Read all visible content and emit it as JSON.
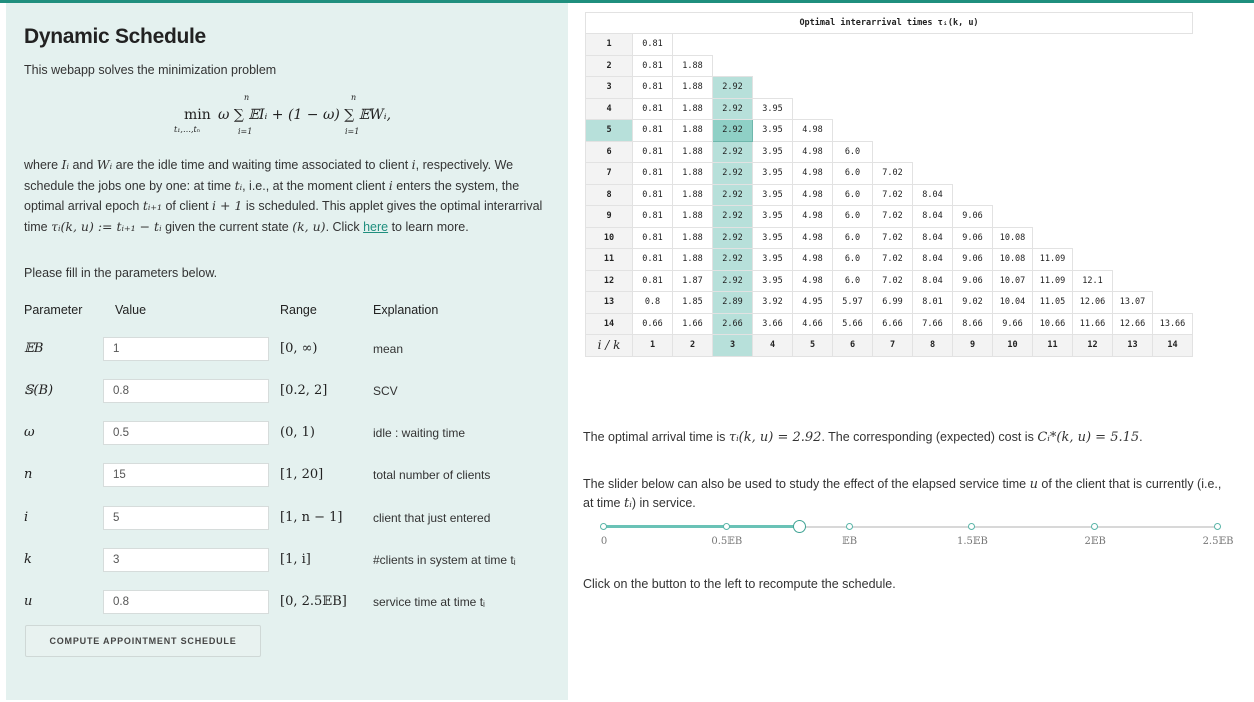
{
  "title": "Dynamic Schedule",
  "intro": "This webapp solves the minimization problem",
  "formula": {
    "min": "min",
    "subscript": "t₁,…,tₙ",
    "expr": "ω ∑ 𝔼Iᵢ + (1 − ω) ∑ 𝔼Wᵢ,",
    "sum_top": "n",
    "sum_bottom": "i=1"
  },
  "description": {
    "p1a": "where ",
    "p1_Ii": "Iᵢ",
    "p1b": " and ",
    "p1_Wi": "Wᵢ",
    "p1c": " are the idle time and waiting time associated to client ",
    "p1_i": "i",
    "p1d": ", respectively. We schedule the jobs one by one: at time ",
    "p1_ti": "tᵢ",
    "p1e": ", i.e., at the moment client ",
    "p1_i2": "i",
    "p1f": " enters the system, the optimal arrival epoch ",
    "p1_ti1": "tᵢ₊₁",
    "p1g": " of client ",
    "p1_i1": "i + 1",
    "p1h": " is scheduled. This applet gives the optimal interarrival time ",
    "p1_tau": "τᵢ(k, u) := tᵢ₊₁ − tᵢ",
    "p1i": " given the current state ",
    "p1_ku": "(k, u)",
    "p1j": ". Click ",
    "link": "here",
    "p1k": " to learn more."
  },
  "fill_in": "Please fill in the parameters below.",
  "param_headers": {
    "parameter": "Parameter",
    "value": "Value",
    "range": "Range",
    "explanation": "Explanation"
  },
  "params": [
    {
      "name": "𝔼B",
      "value": "1",
      "range": "[0, ∞)",
      "explanation": "mean"
    },
    {
      "name": "𝕊(B)",
      "value": "0.8",
      "range": "[0.2, 2]",
      "explanation": "SCV"
    },
    {
      "name": "ω",
      "value": "0.5",
      "range": "(0, 1)",
      "explanation": "idle : waiting time"
    },
    {
      "name": "n",
      "value": "15",
      "range": "[1, 20]",
      "explanation": "total number of clients"
    },
    {
      "name": "i",
      "value": "5",
      "range": "[1, n − 1]",
      "explanation": "client that just entered"
    },
    {
      "name": "k",
      "value": "3",
      "range": "[1, i]",
      "explanation": "#clients in system at time tᵢ"
    },
    {
      "name": "u",
      "value": "0.8",
      "range": "[0, 2.5𝔼B]",
      "explanation": "service time at time tᵢ"
    }
  ],
  "button_label": "COMPUTE APPOINTMENT SCHEDULE",
  "table": {
    "title": "Optimal interarrival times τᵢ(k, u)",
    "corner": "i / k",
    "col_headers": [
      "1",
      "2",
      "3",
      "4",
      "5",
      "6",
      "7",
      "8",
      "9",
      "10",
      "11",
      "12",
      "13",
      "14"
    ],
    "highlight_row": 5,
    "highlight_col": 3,
    "rows": [
      {
        "label": "1",
        "values": [
          "0.81"
        ]
      },
      {
        "label": "2",
        "values": [
          "0.81",
          "1.88"
        ]
      },
      {
        "label": "3",
        "values": [
          "0.81",
          "1.88",
          "2.92"
        ]
      },
      {
        "label": "4",
        "values": [
          "0.81",
          "1.88",
          "2.92",
          "3.95"
        ]
      },
      {
        "label": "5",
        "values": [
          "0.81",
          "1.88",
          "2.92",
          "3.95",
          "4.98"
        ]
      },
      {
        "label": "6",
        "values": [
          "0.81",
          "1.88",
          "2.92",
          "3.95",
          "4.98",
          "6.0"
        ]
      },
      {
        "label": "7",
        "values": [
          "0.81",
          "1.88",
          "2.92",
          "3.95",
          "4.98",
          "6.0",
          "7.02"
        ]
      },
      {
        "label": "8",
        "values": [
          "0.81",
          "1.88",
          "2.92",
          "3.95",
          "4.98",
          "6.0",
          "7.02",
          "8.04"
        ]
      },
      {
        "label": "9",
        "values": [
          "0.81",
          "1.88",
          "2.92",
          "3.95",
          "4.98",
          "6.0",
          "7.02",
          "8.04",
          "9.06"
        ]
      },
      {
        "label": "10",
        "values": [
          "0.81",
          "1.88",
          "2.92",
          "3.95",
          "4.98",
          "6.0",
          "7.02",
          "8.04",
          "9.06",
          "10.08"
        ]
      },
      {
        "label": "11",
        "values": [
          "0.81",
          "1.88",
          "2.92",
          "3.95",
          "4.98",
          "6.0",
          "7.02",
          "8.04",
          "9.06",
          "10.08",
          "11.09"
        ]
      },
      {
        "label": "12",
        "values": [
          "0.81",
          "1.87",
          "2.92",
          "3.95",
          "4.98",
          "6.0",
          "7.02",
          "8.04",
          "9.06",
          "10.07",
          "11.09",
          "12.1"
        ]
      },
      {
        "label": "13",
        "values": [
          "0.8",
          "1.85",
          "2.89",
          "3.92",
          "4.95",
          "5.97",
          "6.99",
          "8.01",
          "9.02",
          "10.04",
          "11.05",
          "12.06",
          "13.07"
        ]
      },
      {
        "label": "14",
        "values": [
          "0.66",
          "1.66",
          "2.66",
          "3.66",
          "4.66",
          "5.66",
          "6.66",
          "7.66",
          "8.66",
          "9.66",
          "10.66",
          "11.66",
          "12.66",
          "13.66"
        ]
      }
    ]
  },
  "result": {
    "a": "The optimal arrival time is ",
    "tau": "τᵢ(k, u) = 2.92",
    "b": ". The corresponding (expected) cost is ",
    "cost": "Cᵢ*(k, u) = 5.15",
    "c": "."
  },
  "slider_text": {
    "a": "The slider below can also be used to study the effect of the elapsed service time ",
    "u": "u",
    "b": " of the client that is currently (i.e., at time ",
    "ti": "tᵢ",
    "c": ") in service."
  },
  "slider": {
    "labels": [
      "0",
      "0.5𝔼B",
      "𝔼B",
      "1.5𝔼B",
      "2𝔼B",
      "2.5𝔼B"
    ],
    "value": 0.8,
    "max": 2.5,
    "color": "#5ab5a8"
  },
  "click_text": "Click on the button to the left to recompute the schedule.",
  "colors": {
    "accent": "#1f8f7e",
    "panel": "#e4f1ef",
    "highlight": "#b7e0da"
  }
}
